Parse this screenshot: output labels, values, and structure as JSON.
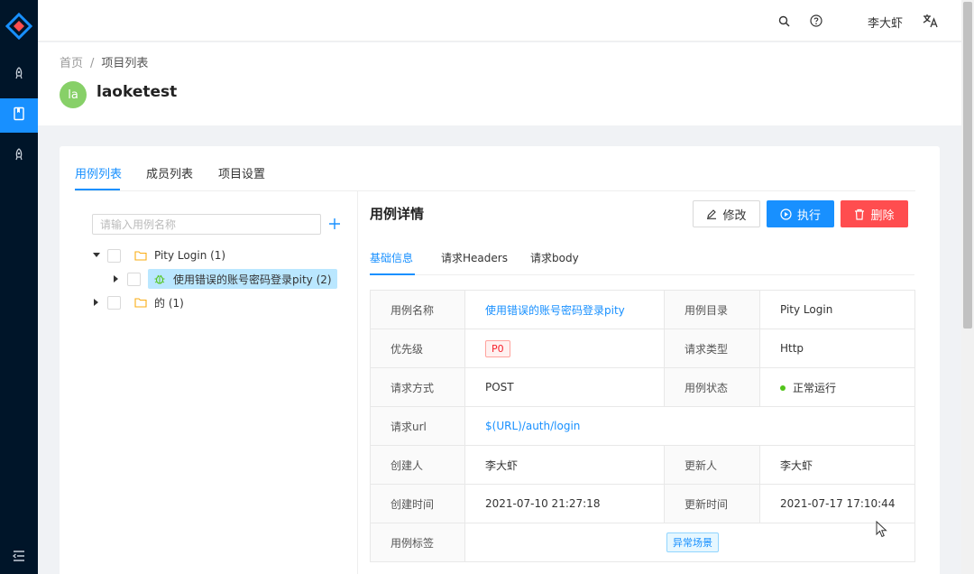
{
  "sidebar": {
    "items": [
      {
        "icon": "rocket-icon"
      },
      {
        "icon": "book-icon",
        "active": true
      },
      {
        "icon": "rocket-icon"
      }
    ],
    "collapse_icon": "menu-fold-icon"
  },
  "header": {
    "search_icon": "search-icon",
    "help_icon": "question-circle-icon",
    "username": "李大虾",
    "language_icon": "translate-icon"
  },
  "breadcrumb": {
    "home": "首页",
    "separator": "/",
    "current": "项目列表"
  },
  "project": {
    "avatar_text": "la",
    "avatar_color": "#87d068",
    "name": "laoketest"
  },
  "tabs": [
    {
      "label": "用例列表",
      "active": true
    },
    {
      "label": "成员列表",
      "active": false
    },
    {
      "label": "项目设置",
      "active": false
    }
  ],
  "tree": {
    "search_placeholder": "请输入用例名称",
    "nodes": [
      {
        "label": "Pity Login (1)",
        "expanded": true
      },
      {
        "label": "使用错误的账号密码登录pity (2)",
        "selected": true
      },
      {
        "label": "的 (1)",
        "expanded": false
      }
    ]
  },
  "detail": {
    "title": "用例详情",
    "edit_label": "修改",
    "run_label": "执行",
    "delete_label": "删除",
    "tabs": [
      {
        "label": "基础信息",
        "active": true
      },
      {
        "label": "请求Headers",
        "active": false
      },
      {
        "label": "请求body",
        "active": false
      }
    ],
    "fields": {
      "name_label": "用例名称",
      "name_value": "使用错误的账号密码登录pity",
      "dir_label": "用例目录",
      "dir_value": "Pity Login",
      "priority_label": "优先级",
      "priority_value": "P0",
      "req_type_label": "请求类型",
      "req_type_value": "Http",
      "method_label": "请求方式",
      "method_value": "POST",
      "status_label": "用例状态",
      "status_value": "正常运行",
      "url_label": "请求url",
      "url_value": "$(URL)/auth/login",
      "creator_label": "创建人",
      "creator_value": "李大虾",
      "updater_label": "更新人",
      "updater_value": "李大虾",
      "created_label": "创建时间",
      "created_value": "2021-07-10 21:27:18",
      "updated_label": "更新时间",
      "updated_value": "2021-07-17 17:10:44",
      "tag_label": "用例标签",
      "tag_value": "异常场景"
    }
  },
  "colors": {
    "primary": "#1890ff",
    "danger": "#ff4d4f",
    "sider": "#001529",
    "success": "#52c41a"
  }
}
